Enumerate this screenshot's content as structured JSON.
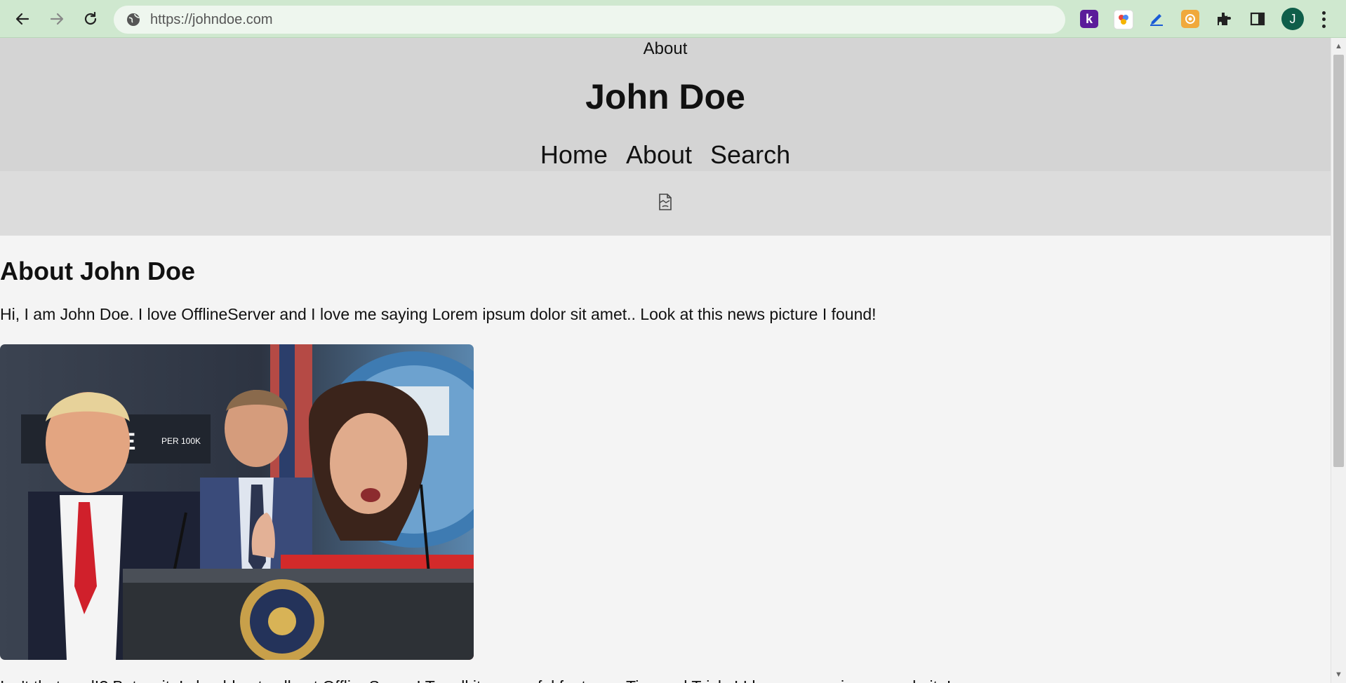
{
  "browser": {
    "url": "https://johndoe.com",
    "back_icon": "back-arrow-icon",
    "forward_icon": "forward-arrow-icon",
    "reload_icon": "reload-icon",
    "extensions": [
      {
        "name": "k-extension-icon",
        "letter": "k",
        "color": "#5b1c9a"
      },
      {
        "name": "color-picker-extension-icon",
        "letter": "",
        "color": "#ffffff"
      },
      {
        "name": "pen-extension-icon",
        "letter": "",
        "color": "#1a5bd6"
      },
      {
        "name": "record-extension-icon",
        "letter": "",
        "color": "#f0a93c"
      }
    ],
    "avatar_initial": "J",
    "avatar_color": "#0f5e4a"
  },
  "header": {
    "breadcrumb": "About",
    "title": "John Doe",
    "nav": [
      {
        "label": "Home"
      },
      {
        "label": "About"
      },
      {
        "label": "Search"
      }
    ]
  },
  "banner": {
    "icon": "broken-image-icon"
  },
  "main": {
    "heading": "About John Doe",
    "intro": "Hi, I am John Doe. I love OfflineServer and I love me saying Lorem ipsum dolor sit amet.. Look at this news picture I found!",
    "photo_icon": "news-photo",
    "outro": "Isn't that cool!? But wait, I should not sell out OfflineServer! Try all its powerful features. Tips and Tricks! I hope you enjoy my website!"
  },
  "colors": {
    "chrome_bg": "#cfe8cf",
    "header_bg": "#d4d4d4",
    "banner_bg": "#dcdcdc",
    "page_bg": "#f4f4f4"
  }
}
